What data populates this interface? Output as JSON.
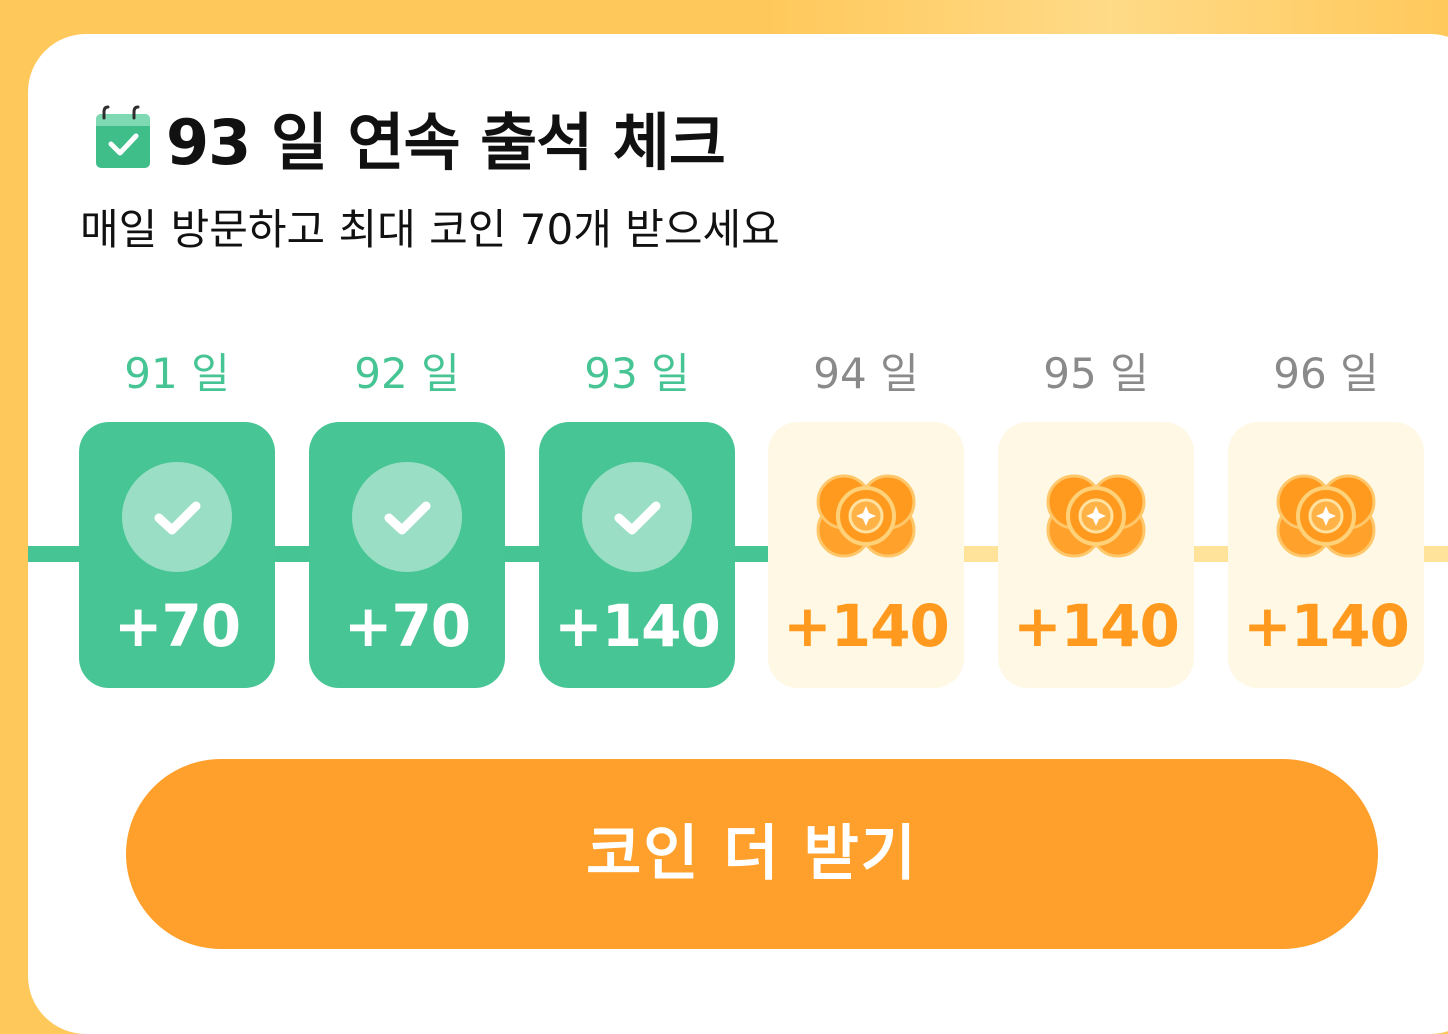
{
  "header": {
    "title": "93 일 연속 출석 체크",
    "title_icon": "calendar-check-icon",
    "subtitle": "매일 방문하고 최대 코인 70개 받으세요"
  },
  "streak": {
    "days": [
      {
        "label": "91 일",
        "reward": "+70",
        "status": "checked"
      },
      {
        "label": "92 일",
        "reward": "+70",
        "status": "checked"
      },
      {
        "label": "93 일",
        "reward": "+140",
        "status": "checked"
      },
      {
        "label": "94 일",
        "reward": "+140",
        "status": "upcoming"
      },
      {
        "label": "95 일",
        "reward": "+140",
        "status": "upcoming"
      },
      {
        "label": "96 일",
        "reward": "+140",
        "status": "upcoming"
      }
    ]
  },
  "cta": {
    "label": "코인 더 받기"
  },
  "colors": {
    "background": "#FFC85A",
    "checked": "#48C595",
    "accent_orange": "#FFA02C",
    "reward_orange": "#FF9A1F",
    "upcoming_tile": "#FFF8E5",
    "track_upcoming": "#FFE39A"
  }
}
